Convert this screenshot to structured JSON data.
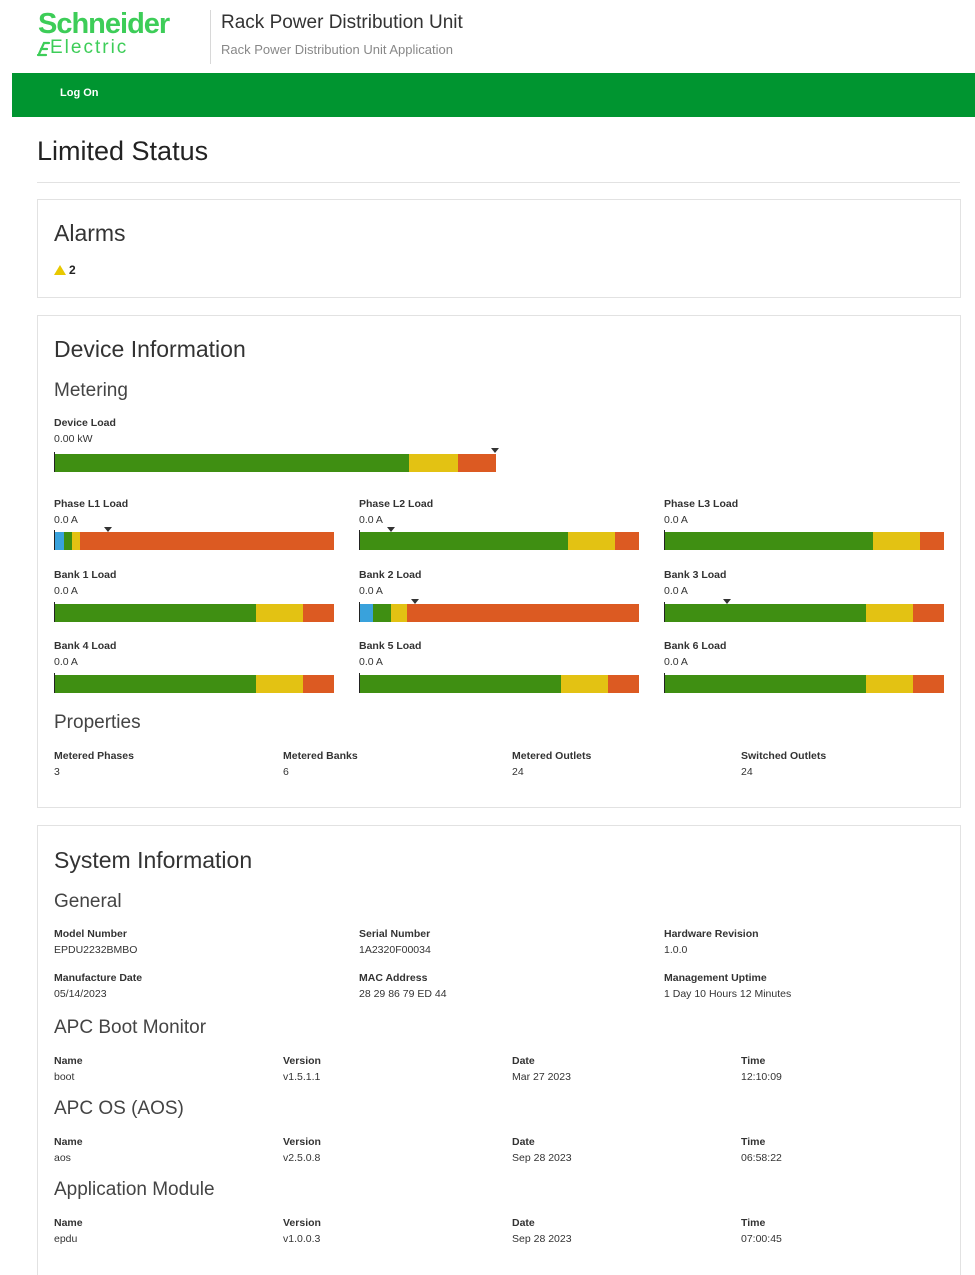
{
  "header": {
    "logo_top": "Schneider",
    "logo_bottom": "Electric",
    "title": "Rack Power Distribution Unit",
    "subtitle": "Rack Power Distribution Unit Application"
  },
  "nav": {
    "logon_label": "Log On"
  },
  "page": {
    "title": "Limited Status"
  },
  "alarms": {
    "title": "Alarms",
    "count": "2"
  },
  "device": {
    "title": "Device Information",
    "metering_title": "Metering",
    "device_load": {
      "label": "Device Load",
      "value": "0.00 kW"
    },
    "phases": [
      {
        "label": "Phase L1 Load",
        "value": "0.0 A"
      },
      {
        "label": "Phase L2 Load",
        "value": "0.0 A"
      },
      {
        "label": "Phase L3 Load",
        "value": "0.0 A"
      }
    ],
    "banks": [
      {
        "label": "Bank 1 Load",
        "value": "0.0 A"
      },
      {
        "label": "Bank 2 Load",
        "value": "0.0 A"
      },
      {
        "label": "Bank 3 Load",
        "value": "0.0 A"
      },
      {
        "label": "Bank 4 Load",
        "value": "0.0 A"
      },
      {
        "label": "Bank 5 Load",
        "value": "0.0 A"
      },
      {
        "label": "Bank 6 Load",
        "value": "0.0 A"
      }
    ],
    "properties_title": "Properties",
    "properties": [
      {
        "label": "Metered Phases",
        "value": "3"
      },
      {
        "label": "Metered Banks",
        "value": "6"
      },
      {
        "label": "Metered Outlets",
        "value": "24"
      },
      {
        "label": "Switched Outlets",
        "value": "24"
      }
    ]
  },
  "system": {
    "title": "System Information",
    "general_title": "General",
    "general": [
      {
        "label": "Model Number",
        "value": "EPDU2232BMBO"
      },
      {
        "label": "Serial Number",
        "value": "1A2320F00034"
      },
      {
        "label": "Hardware Revision",
        "value": "1.0.0"
      },
      {
        "label": "Manufacture Date",
        "value": "05/14/2023"
      },
      {
        "label": "MAC Address",
        "value": "28 29 86 79 ED 44"
      },
      {
        "label": "Management Uptime",
        "value": "1 Day 10 Hours 12 Minutes"
      }
    ],
    "col_labels": {
      "name": "Name",
      "version": "Version",
      "date": "Date",
      "time": "Time"
    },
    "modules": [
      {
        "title": "APC Boot Monitor",
        "name": "boot",
        "version": "v1.5.1.1",
        "date": "Mar 27 2023",
        "time": "12:10:09"
      },
      {
        "title": "APC OS (AOS)",
        "name": "aos",
        "version": "v2.5.0.8",
        "date": "Sep 28 2023",
        "time": "06:58:22"
      },
      {
        "title": "Application Module",
        "name": "epdu",
        "version": "v1.0.0.3",
        "date": "Sep 28 2023",
        "time": "07:00:45"
      }
    ]
  },
  "colors": {
    "brand_green": "#009530",
    "logo_green": "#3dcd58",
    "bar_green": "#3f8f12",
    "bar_yellow": "#e3c213",
    "bar_red": "#dc5a22",
    "bar_blue": "#39a2dc"
  }
}
